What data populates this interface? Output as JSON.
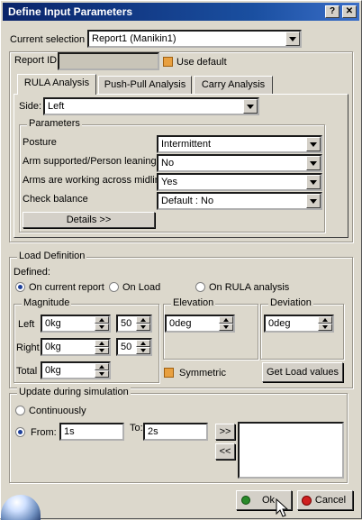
{
  "window": {
    "title": "Define Input Parameters",
    "help_label": "?",
    "close_label": "✕"
  },
  "current_selection": {
    "label": "Current selection :",
    "value": "Report1 (Manikin1)"
  },
  "report": {
    "id_label": "Report ID:",
    "id_value": "",
    "use_default_label": "Use default",
    "use_default_checked": true
  },
  "tabs": [
    {
      "label": "RULA Analysis",
      "active": true
    },
    {
      "label": "Push-Pull Analysis",
      "active": false
    },
    {
      "label": "Carry Analysis",
      "active": false
    }
  ],
  "side": {
    "label": "Side:",
    "value": "Left"
  },
  "parameters": {
    "title": "Parameters",
    "rows": [
      {
        "label": "Posture",
        "value": "Intermittent"
      },
      {
        "label": "Arm supported/Person leaning",
        "value": "No"
      },
      {
        "label": "Arms are working across midline",
        "value": "Yes"
      },
      {
        "label": "Check balance",
        "value": "Default : No"
      }
    ],
    "details_label": "Details >>"
  },
  "load_definition": {
    "title": "Load Definition",
    "defined_label": "Defined:",
    "options": [
      {
        "label": "On current report",
        "selected": true
      },
      {
        "label": "On Load",
        "selected": false
      },
      {
        "label": "On RULA analysis",
        "selected": false
      }
    ],
    "magnitude": {
      "title": "Magnitude",
      "left_label": "Left",
      "left_value": "0kg",
      "left_pct": "50",
      "right_label": "Right",
      "right_value": "0kg",
      "right_pct": "50",
      "total_label": "Total",
      "total_value": "0kg"
    },
    "elevation": {
      "title": "Elevation",
      "value": "0deg"
    },
    "deviation": {
      "title": "Deviation",
      "value": "0deg"
    },
    "symmetric_label": "Symmetric",
    "symmetric_checked": true,
    "get_load_label": "Get Load values"
  },
  "update": {
    "title": "Update during simulation",
    "continuously_label": "Continuously",
    "continuously_selected": false,
    "from_label": "From:",
    "from_value": "1s",
    "from_selected": true,
    "to_label": "To:",
    "to_value": "2s",
    "add_label": ">>",
    "remove_label": "<<"
  },
  "buttons": {
    "ok_label": "Ok",
    "cancel_label": "Cancel"
  }
}
